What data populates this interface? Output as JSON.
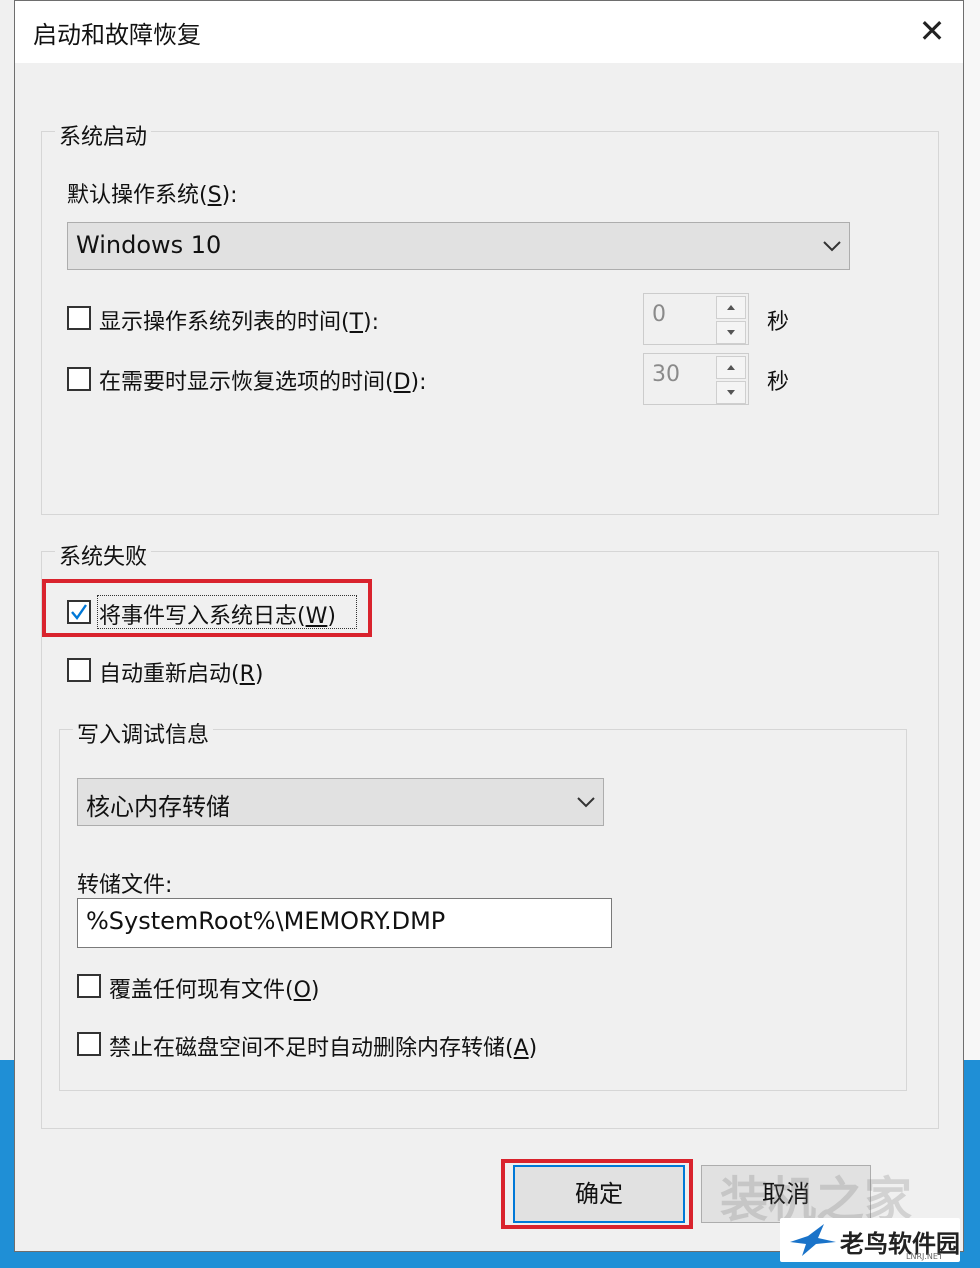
{
  "window": {
    "title": "启动和故障恢复",
    "close_symbol": "✕"
  },
  "system_startup": {
    "legend": "系统启动",
    "default_os_label": "默认操作系统(",
    "default_os_key": "S",
    "default_os_label_end": "):",
    "default_os_value": "Windows 10",
    "show_os_list": {
      "label": "显示操作系统列表的时间(",
      "key": "T",
      "label_end": "):",
      "checked": false,
      "value": "0",
      "unit": "秒"
    },
    "show_recovery": {
      "label": "在需要时显示恢复选项的时间(",
      "key": "D",
      "label_end": "):",
      "checked": false,
      "value": "30",
      "unit": "秒"
    }
  },
  "system_failure": {
    "legend": "系统失败",
    "write_event": {
      "label": "将事件写入系统日志(",
      "key": "W",
      "label_end": ")",
      "checked": true
    },
    "auto_restart": {
      "label": "自动重新启动(",
      "key": "R",
      "label_end": ")",
      "checked": false
    },
    "debug_info": {
      "legend": "写入调试信息",
      "dump_type": "核心内存转储",
      "dump_file_label": "转储文件:",
      "dump_file_value": "%SystemRoot%\\MEMORY.DMP",
      "overwrite": {
        "label": "覆盖任何现有文件(",
        "key": "O",
        "label_end": ")",
        "checked": false
      },
      "disable_auto_delete": {
        "label": "禁止在磁盘空间不足时自动删除内存转储(",
        "key": "A",
        "label_end": ")",
        "checked": false
      }
    }
  },
  "buttons": {
    "ok": "确定",
    "cancel": "取消"
  },
  "watermark": {
    "brand": "老鸟软件园",
    "sub": "LNRJ.NET",
    "bg": "装机之家"
  },
  "colors": {
    "highlight": "#d9232d",
    "focus": "#0078d7",
    "desktop": "#1f8fd6"
  }
}
